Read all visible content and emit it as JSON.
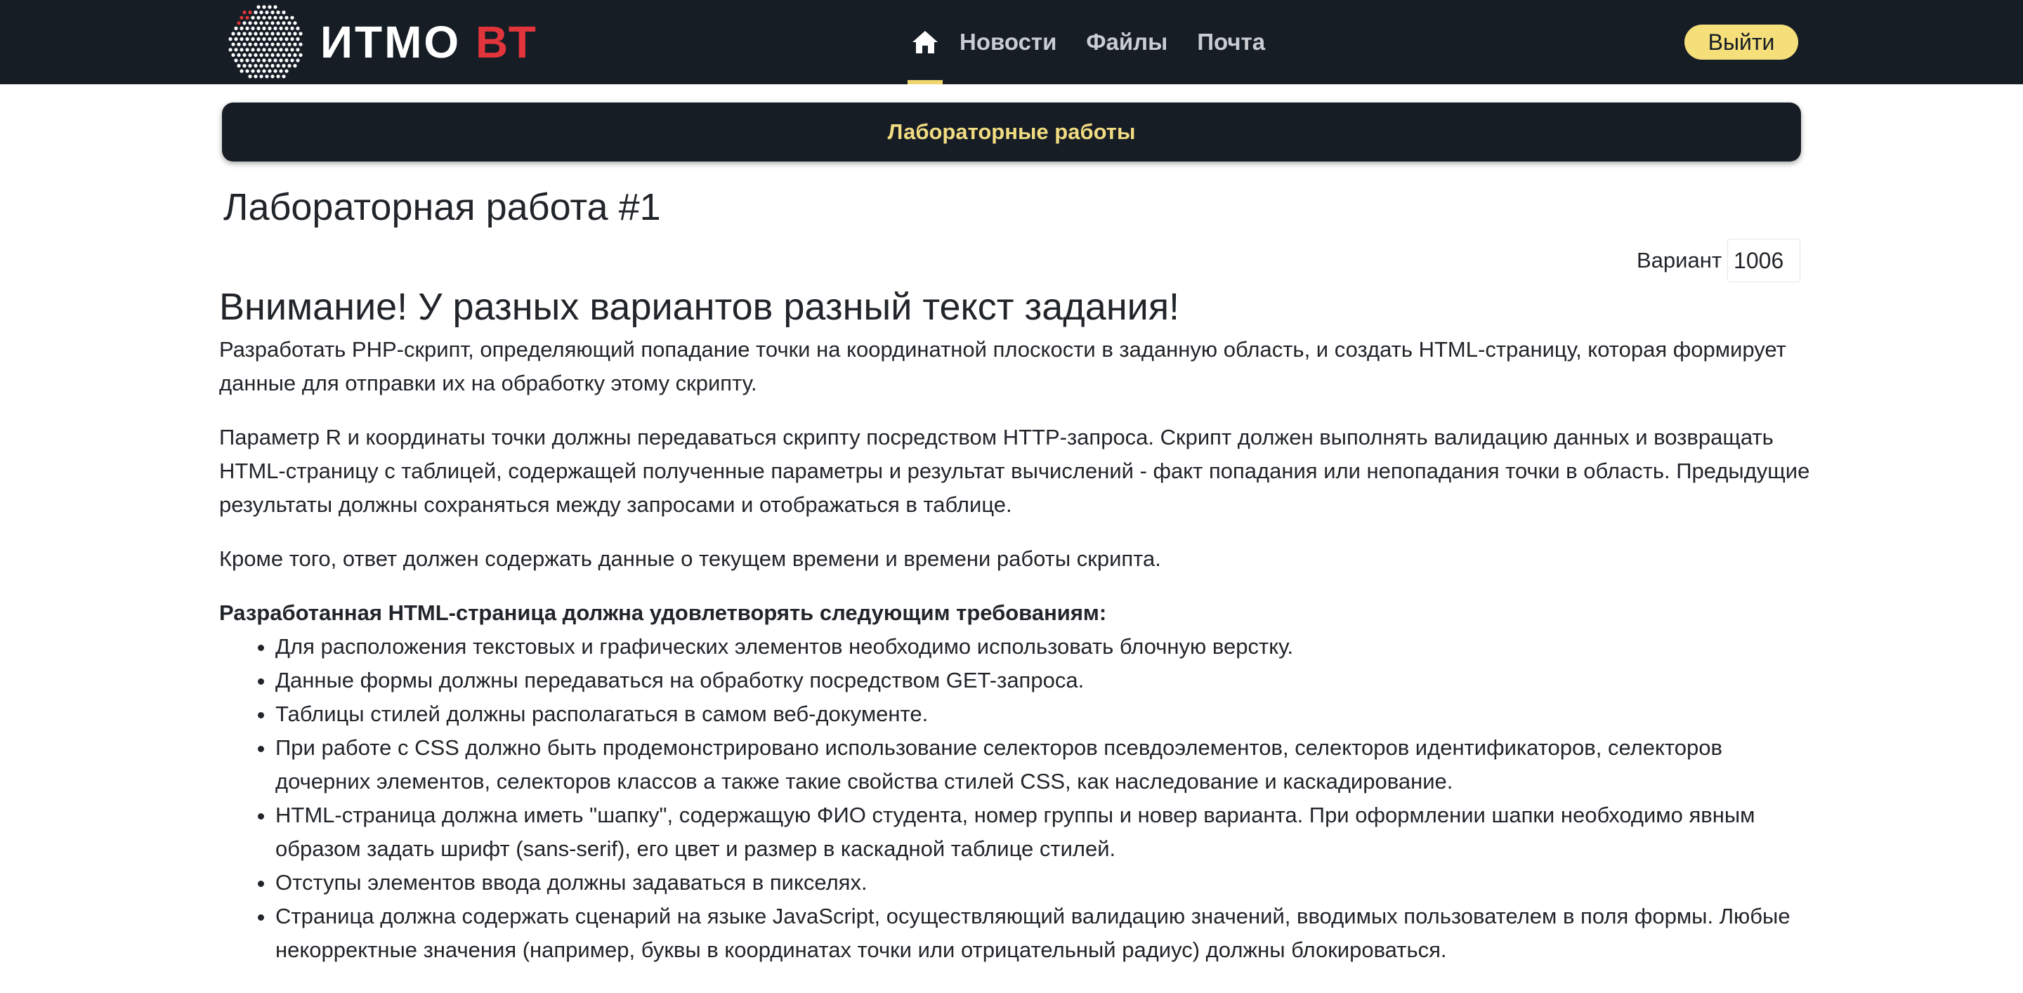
{
  "navbar": {
    "brand_main": "ИТМО",
    "brand_accent": "ВТ",
    "home_icon": "home-icon",
    "links": [
      "Новости",
      "Файлы",
      "Почта"
    ],
    "logout_label": "Выйти",
    "colors": {
      "background": "#161d25",
      "accent": "#f0d66f",
      "brand_red": "#e2343b"
    }
  },
  "banner": {
    "title": "Лабораторные работы"
  },
  "page": {
    "title": "Лабораторная работа #1",
    "variant_label": "Вариант",
    "variant_value": "1006"
  },
  "content": {
    "warning": "Внимание! У разных вариантов разный текст задания!",
    "paragraphs": [
      "Разработать PHP-скрипт, определяющий попадание точки на координатной плоскости в заданную область, и создать HTML-страницу, которая формирует данные для отправки их на обработку этому скрипту.",
      "Параметр R и координаты точки должны передаваться скрипту посредством HTTP-запроса. Скрипт должен выполнять валидацию данных и возвращать HTML-страницу с таблицей, содержащей полученные параметры и результат вычислений - факт попадания или непопадания точки в область. Предыдущие результаты должны сохраняться между запросами и отображаться в таблице.",
      "Кроме того, ответ должен содержать данные о текущем времени и времени работы скрипта."
    ],
    "requirements_title": "Разработанная HTML-страница должна удовлетворять следующим требованиям:",
    "requirements": [
      "Для расположения текстовых и графических элементов необходимо использовать блочную верстку.",
      "Данные формы должны передаваться на обработку посредством GET-запроса.",
      "Таблицы стилей должны располагаться в самом веб-документе.",
      "При работе с CSS должно быть продемонстрировано использование селекторов псевдоэлементов, селекторов идентификаторов, селекторов дочерних элементов, селекторов классов а также такие свойства стилей CSS, как наследование и каскадирование.",
      "HTML-страница должна иметь \"шапку\", содержащую ФИО студента, номер группы и новер варианта. При оформлении шапки необходимо явным образом задать шрифт (sans-serif), его цвет и размер в каскадной таблице стилей.",
      "Отступы элементов ввода должны задаваться в пикселях.",
      "Страница должна содержать сценарий на языке JavaScript, осуществляющий валидацию значений, вводимых пользователем в поля формы. Любые некорректные значения (например, буквы в координатах точки или отрицательный радиус) должны блокироваться."
    ]
  }
}
